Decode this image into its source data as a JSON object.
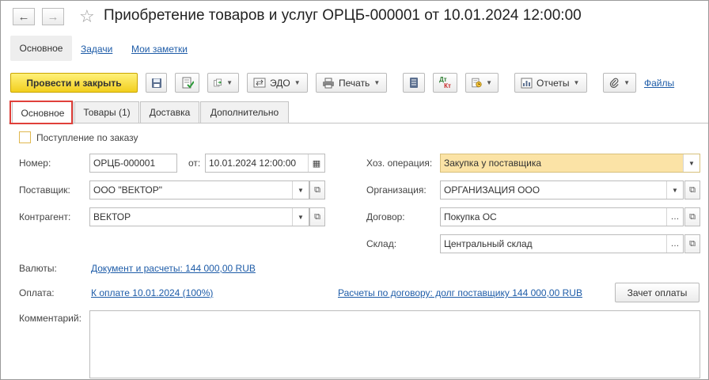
{
  "window": {
    "title": "Приобретение товаров и услуг ОРЦБ-000001 от 10.01.2024 12:00:00"
  },
  "nav": {
    "back": "←",
    "forward": "→",
    "star": "☆",
    "main": "Основное",
    "tasks": "Задачи",
    "notes": "Мои заметки"
  },
  "toolbar": {
    "post_close": "Провести и закрыть",
    "edo": "ЭДО",
    "print": "Печать",
    "reports": "Отчеты",
    "files": "Файлы",
    "dtkt_dt": "Дт",
    "dtkt_kt": "Кт"
  },
  "tabs": [
    {
      "label": "Основное"
    },
    {
      "label": "Товары (1)"
    },
    {
      "label": "Доставка"
    },
    {
      "label": "Дополнительно"
    }
  ],
  "form": {
    "by_order_label": "Поступление по заказу",
    "number_label": "Номер:",
    "number_value": "ОРЦБ-000001",
    "date_label": "от:",
    "date_value": "10.01.2024 12:00:00",
    "supplier_label": "Поставщик:",
    "supplier_value": "ООО \"ВЕКТОР\"",
    "counterparty_label": "Контрагент:",
    "counterparty_value": "ВЕКТОР",
    "operation_label": "Хоз. операция:",
    "operation_value": "Закупка у поставщика",
    "org_label": "Организация:",
    "org_value": "ОРГАНИЗАЦИЯ ООО",
    "contract_label": "Договор:",
    "contract_value": "Покупка ОС",
    "warehouse_label": "Склад:",
    "warehouse_value": "Центральный склад",
    "currency_label": "Валюты:",
    "currency_link": "Документ и расчеты: 144 000,00 RUB",
    "payment_label": "Оплата:",
    "payment_link": "К оплате 10.01.2024 (100%)",
    "settlement_link": "Расчеты по договору: долг поставщику 144 000,00 RUB",
    "offset_button": "Зачет оплаты",
    "comment_label": "Комментарий:",
    "comment_value": ""
  },
  "colors": {
    "primary_button": "#f2cf1e",
    "highlight_box": "#e0403a",
    "link": "#1e5ca8",
    "operation_field": "#fbe3a6"
  }
}
